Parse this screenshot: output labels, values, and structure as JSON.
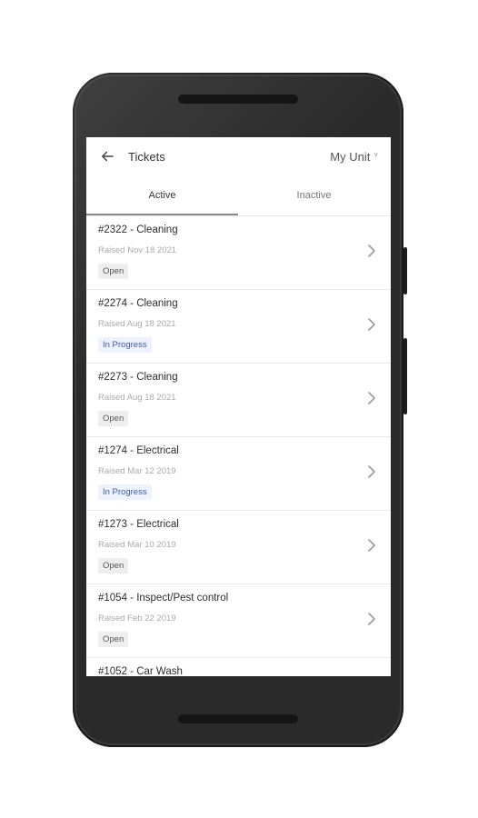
{
  "header": {
    "title": "Tickets",
    "unit_label": "My Unit",
    "unit_caret": "˅"
  },
  "tabs": [
    {
      "label": "Active",
      "active": true
    },
    {
      "label": "Inactive",
      "active": false
    }
  ],
  "tickets": [
    {
      "title": "#2322 - Cleaning",
      "date": "Raised Nov 18 2021",
      "status": "Open"
    },
    {
      "title": "#2274 - Cleaning",
      "date": "Raised Aug 18 2021",
      "status": "In Progress"
    },
    {
      "title": "#2273 - Cleaning",
      "date": "Raised Aug 18 2021",
      "status": "Open"
    },
    {
      "title": "#1274 - Electrical",
      "date": "Raised Mar 12 2019",
      "status": "In Progress"
    },
    {
      "title": "#1273 - Electrical",
      "date": "Raised Mar 10 2019",
      "status": "Open"
    },
    {
      "title": "#1054 - Inspect/Pest control",
      "date": "Raised Feb 22 2019",
      "status": "Open"
    },
    {
      "title": "#1052 - Car Wash"
    }
  ],
  "colors": {
    "open_badge_bg": "#eeeeee",
    "progress_badge_bg": "#eef2ff",
    "progress_text": "#3d5ba9",
    "phone_body": "#2a2a2a"
  },
  "icons": {
    "back": "arrow-left-icon",
    "chevron": "chevron-right-icon"
  }
}
